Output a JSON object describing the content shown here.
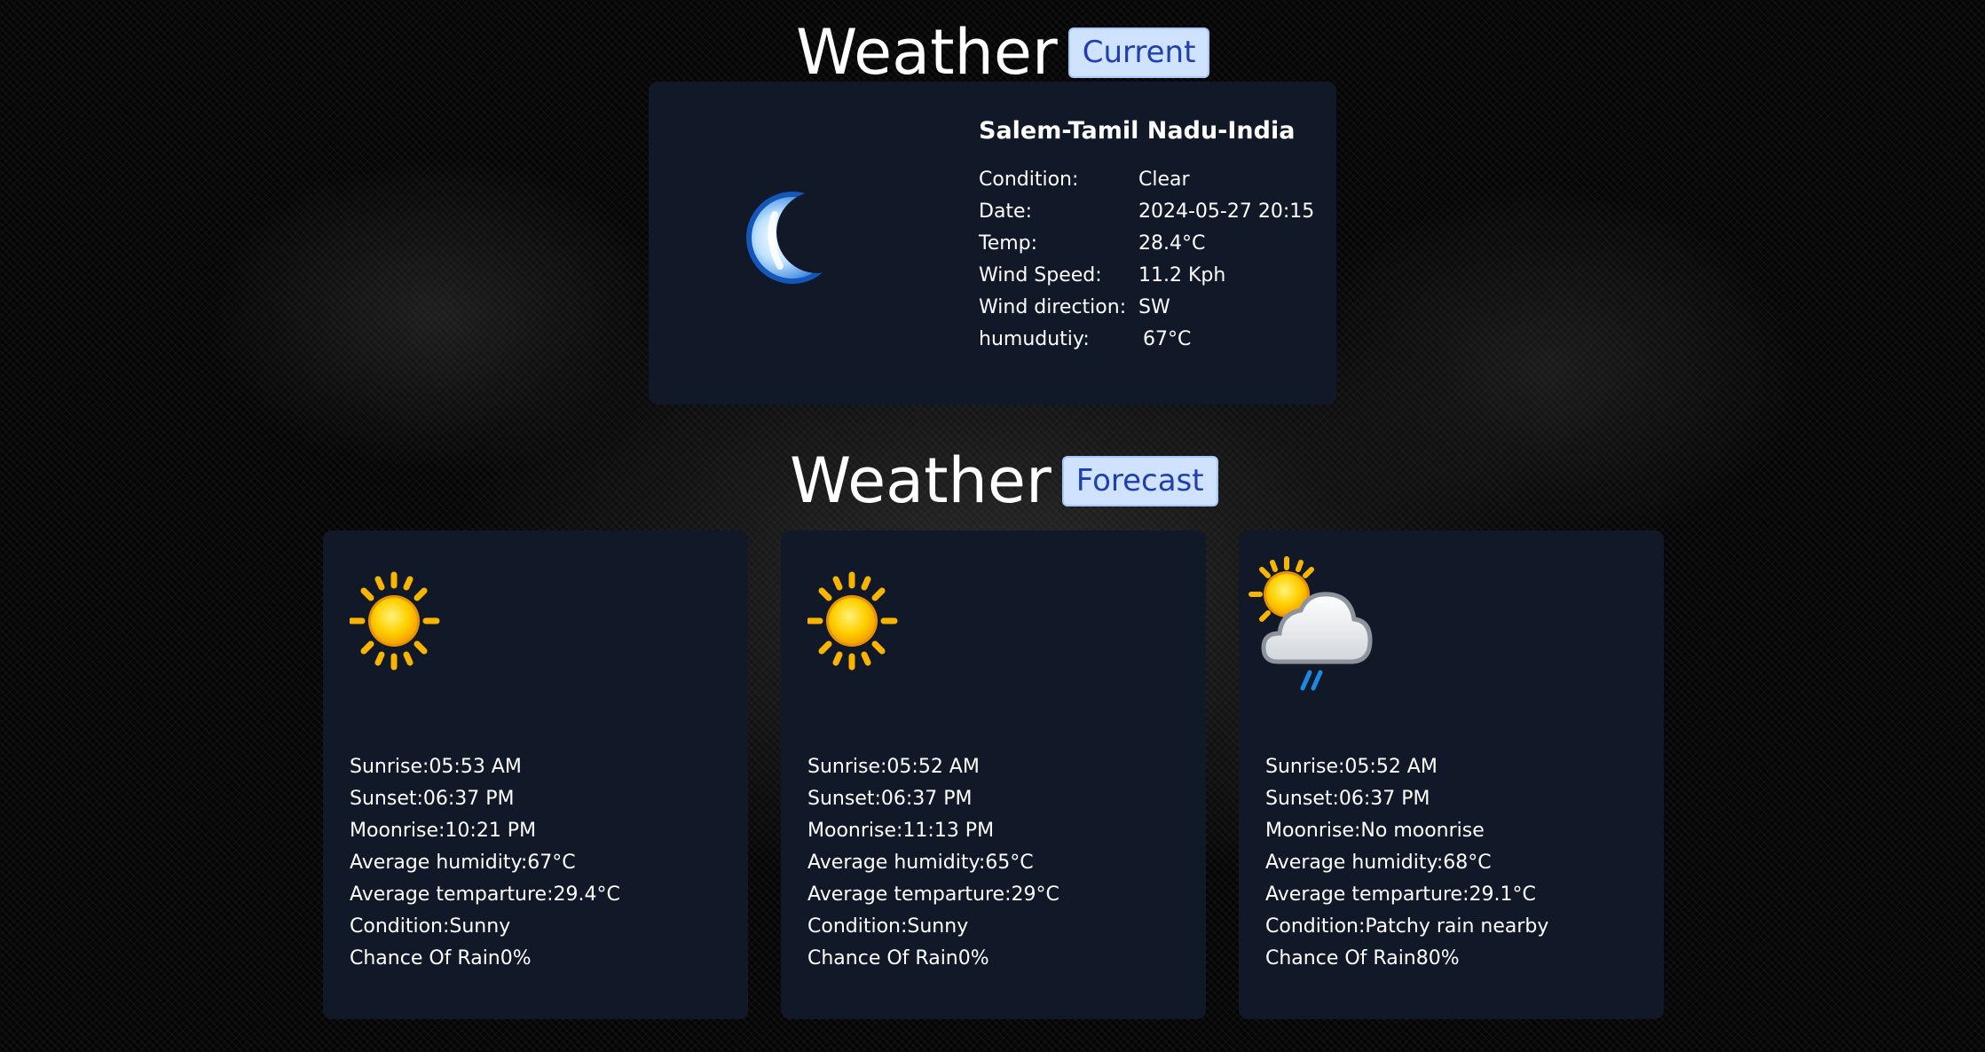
{
  "current_section": {
    "heading": "Weather",
    "badge": "Current"
  },
  "current": {
    "location": "Salem-Tamil Nadu-India",
    "icon": "moon-icon",
    "rows": [
      {
        "label": "Condition:",
        "value": "Clear"
      },
      {
        "label": "Date:",
        "value": "2024-05-27 20:15"
      },
      {
        "label": "Temp:",
        "value": "28.4°C"
      },
      {
        "label": "Wind Speed:",
        "value": "11.2 Kph"
      },
      {
        "label": "Wind direction:",
        "value": "SW"
      },
      {
        "label": "humudutiy:",
        "value": "67°C"
      }
    ]
  },
  "forecast_section": {
    "heading": "Weather",
    "badge": "Forecast"
  },
  "forecast": [
    {
      "icon": "sun-icon",
      "sunrise": "Sunrise:05:53 AM",
      "sunset": "Sunset:06:37 PM",
      "moonrise": "Moonrise:10:21 PM",
      "humidity": "Average humidity:67°C",
      "temperature": "Average temparture:29.4°C",
      "condition": "Condition:Sunny",
      "rain": "Chance Of Rain0%"
    },
    {
      "icon": "sun-icon",
      "sunrise": "Sunrise:05:52 AM",
      "sunset": "Sunset:06:37 PM",
      "moonrise": "Moonrise:11:13 PM",
      "humidity": "Average humidity:65°C",
      "temperature": "Average temparture:29°C",
      "condition": "Condition:Sunny",
      "rain": "Chance Of Rain0%"
    },
    {
      "icon": "sun-cloud-rain-icon",
      "sunrise": "Sunrise:05:52 AM",
      "sunset": "Sunset:06:37 PM",
      "moonrise": "Moonrise:No moonrise",
      "humidity": "Average humidity:68°C",
      "temperature": "Average temparture:29.1°C",
      "condition": "Condition:Patchy rain nearby",
      "rain": "Chance Of Rain80%"
    }
  ],
  "colors": {
    "card_background": "#111827",
    "badge_background": "#cfe2ff",
    "badge_text": "#1f3fae",
    "page_background": "#050505"
  }
}
